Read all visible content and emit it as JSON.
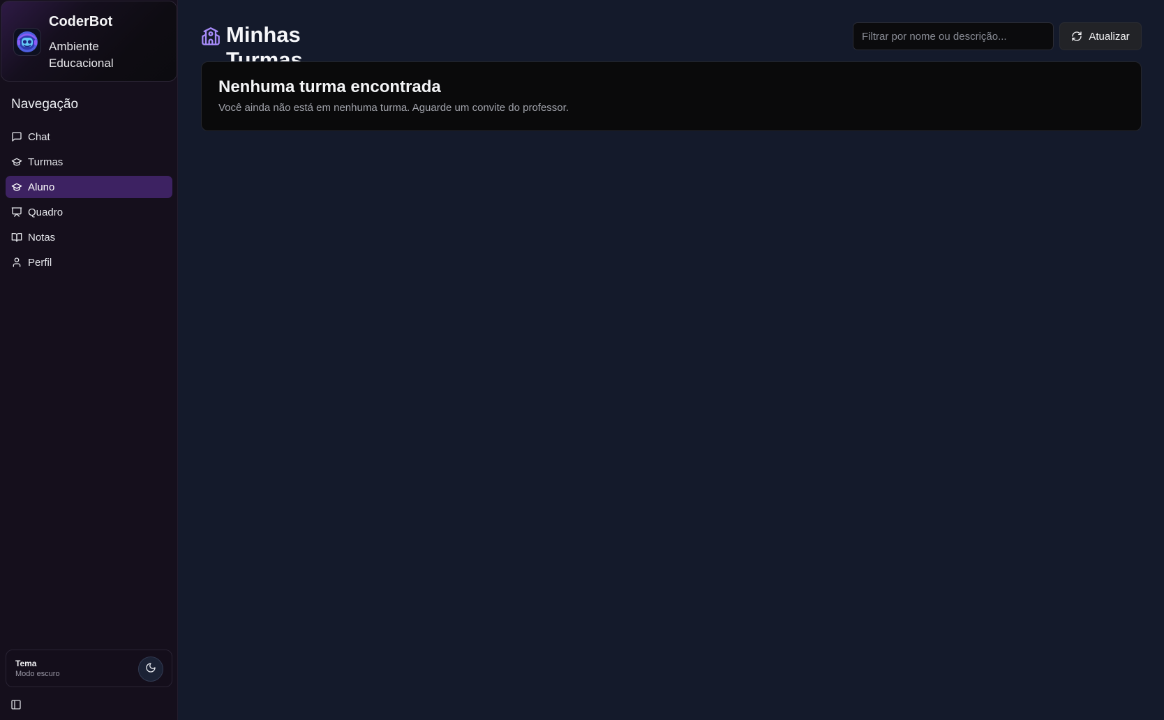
{
  "brand": {
    "title": "CoderBot",
    "subtitle": "Ambiente Educacional"
  },
  "sidebar": {
    "nav_title": "Navegação",
    "items": [
      {
        "label": "Chat",
        "icon": "message-square-icon",
        "active": false
      },
      {
        "label": "Turmas",
        "icon": "graduation-cap-icon",
        "active": false
      },
      {
        "label": "Aluno",
        "icon": "graduation-cap-icon",
        "active": true
      },
      {
        "label": "Quadro",
        "icon": "presentation-icon",
        "active": false
      },
      {
        "label": "Notas",
        "icon": "book-open-icon",
        "active": false
      },
      {
        "label": "Perfil",
        "icon": "user-icon",
        "active": false
      }
    ],
    "theme": {
      "label": "Tema",
      "mode": "Modo escuro",
      "icon": "moon-icon"
    },
    "toggle_icon": "panel-left-icon"
  },
  "header": {
    "title": "Minhas Turmas",
    "icon": "school-icon",
    "search": {
      "placeholder": "Filtrar por nome ou descrição...",
      "value": ""
    },
    "refresh_label": "Atualizar",
    "refresh_icon": "refresh-icon"
  },
  "empty_state": {
    "title": "Nenhuma turma encontrada",
    "description": "Você ainda não está em nenhuma turma. Aguarde um convite do professor."
  },
  "colors": {
    "background": "#141a2b",
    "sidebar": "#150f1c",
    "active_item": "#3d2262",
    "accent_icon": "#a78bfa"
  }
}
